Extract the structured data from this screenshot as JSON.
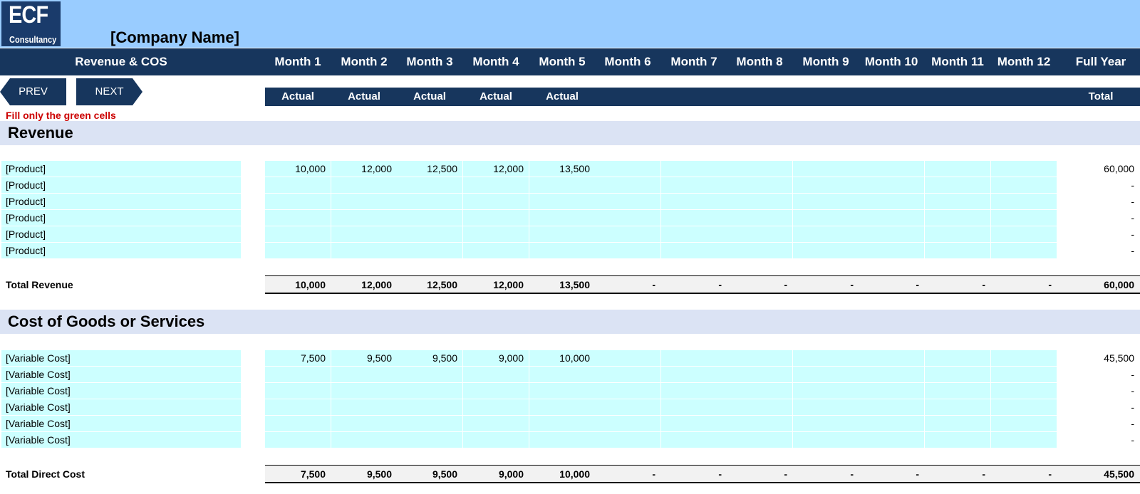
{
  "logo": {
    "main": "ECF",
    "sub": "Consultancy"
  },
  "company_name": "[Company Name]",
  "header": {
    "title": "Revenue & COS",
    "months": [
      "Month 1",
      "Month 2",
      "Month 3",
      "Month 4",
      "Month 5",
      "Month 6",
      "Month 7",
      "Month 8",
      "Month 9",
      "Month 10",
      "Month 11",
      "Month 12"
    ],
    "full_year": "Full Year",
    "status": [
      "Actual",
      "Actual",
      "Actual",
      "Actual",
      "Actual",
      "",
      "",
      "",
      "",
      "",
      "",
      ""
    ],
    "total_label": "Total"
  },
  "nav": {
    "prev": "PREV",
    "next": "NEXT"
  },
  "instruction": "Fill only the green cells",
  "colors": {
    "header_navy": "#17365d",
    "banner_blue": "#99ccff",
    "input_cyan": "#ccffff",
    "section_band": "#dbe3f4",
    "instruction_red": "#cc0000"
  },
  "revenue": {
    "title": "Revenue",
    "rows": [
      {
        "label": "[Product]",
        "values": [
          "10,000",
          "12,000",
          "12,500",
          "12,000",
          "13,500",
          "",
          "",
          "",
          "",
          "",
          "",
          ""
        ],
        "full_year": "60,000"
      },
      {
        "label": "[Product]",
        "values": [
          "",
          "",
          "",
          "",
          "",
          "",
          "",
          "",
          "",
          "",
          "",
          ""
        ],
        "full_year": "-"
      },
      {
        "label": "[Product]",
        "values": [
          "",
          "",
          "",
          "",
          "",
          "",
          "",
          "",
          "",
          "",
          "",
          ""
        ],
        "full_year": "-"
      },
      {
        "label": "[Product]",
        "values": [
          "",
          "",
          "",
          "",
          "",
          "",
          "",
          "",
          "",
          "",
          "",
          ""
        ],
        "full_year": "-"
      },
      {
        "label": "[Product]",
        "values": [
          "",
          "",
          "",
          "",
          "",
          "",
          "",
          "",
          "",
          "",
          "",
          ""
        ],
        "full_year": "-"
      },
      {
        "label": "[Product]",
        "values": [
          "",
          "",
          "",
          "",
          "",
          "",
          "",
          "",
          "",
          "",
          "",
          ""
        ],
        "full_year": "-"
      }
    ],
    "total": {
      "label": "Total Revenue",
      "values": [
        "10,000",
        "12,000",
        "12,500",
        "12,000",
        "13,500",
        "-",
        "-",
        "-",
        "-",
        "-",
        "-",
        "-"
      ],
      "full_year": "60,000"
    }
  },
  "cos": {
    "title": "Cost of Goods or Services",
    "rows": [
      {
        "label": "[Variable Cost]",
        "values": [
          "7,500",
          "9,500",
          "9,500",
          "9,000",
          "10,000",
          "",
          "",
          "",
          "",
          "",
          "",
          ""
        ],
        "full_year": "45,500"
      },
      {
        "label": "[Variable Cost]",
        "values": [
          "",
          "",
          "",
          "",
          "",
          "",
          "",
          "",
          "",
          "",
          "",
          ""
        ],
        "full_year": "-"
      },
      {
        "label": "[Variable Cost]",
        "values": [
          "",
          "",
          "",
          "",
          "",
          "",
          "",
          "",
          "",
          "",
          "",
          ""
        ],
        "full_year": "-"
      },
      {
        "label": "[Variable Cost]",
        "values": [
          "",
          "",
          "",
          "",
          "",
          "",
          "",
          "",
          "",
          "",
          "",
          ""
        ],
        "full_year": "-"
      },
      {
        "label": "[Variable Cost]",
        "values": [
          "",
          "",
          "",
          "",
          "",
          "",
          "",
          "",
          "",
          "",
          "",
          ""
        ],
        "full_year": "-"
      },
      {
        "label": "[Variable Cost]",
        "values": [
          "",
          "",
          "",
          "",
          "",
          "",
          "",
          "",
          "",
          "",
          "",
          ""
        ],
        "full_year": "-"
      }
    ],
    "total": {
      "label": "Total Direct Cost",
      "values": [
        "7,500",
        "9,500",
        "9,500",
        "9,000",
        "10,000",
        "-",
        "-",
        "-",
        "-",
        "-",
        "-",
        "-"
      ],
      "full_year": "45,500"
    }
  }
}
